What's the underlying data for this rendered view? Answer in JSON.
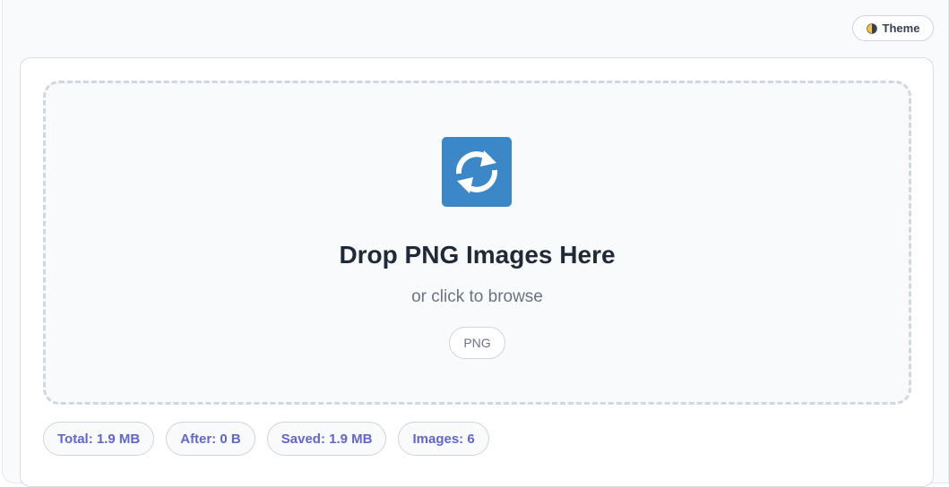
{
  "header": {
    "theme_label": "Theme",
    "theme_icon": "half-circle-icon"
  },
  "dropzone": {
    "icon": "refresh-arrows-icon",
    "icon_color": "#3b87c7",
    "title": "Drop PNG Images Here",
    "subtitle": "or click to browse",
    "formats": [
      "PNG"
    ]
  },
  "stats": {
    "total": "Total: 1.9 MB",
    "after": "After: 0 B",
    "saved": "Saved: 1.9 MB",
    "images": "Images: 6"
  },
  "colors": {
    "accent": "#6366c9",
    "icon_bg": "#3b87c7",
    "theme_icon_left": "#f5c242",
    "theme_icon_right": "#374151"
  }
}
